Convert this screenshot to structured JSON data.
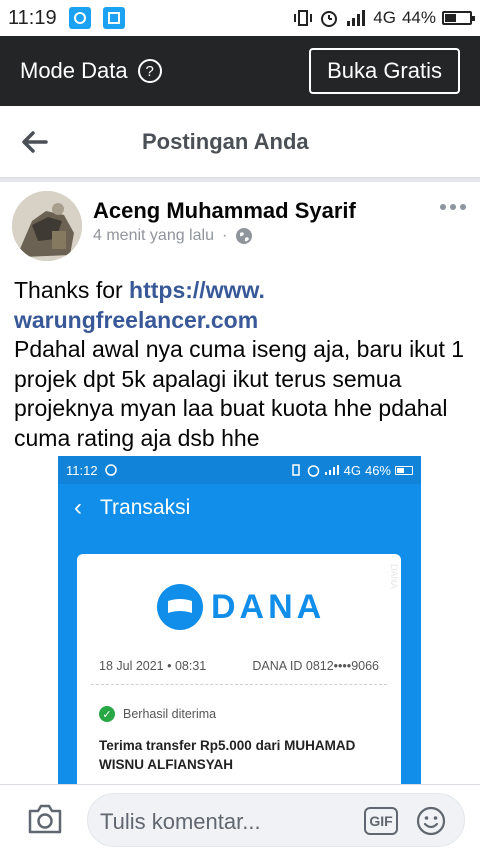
{
  "status_bar": {
    "time": "11:19",
    "network": "4G",
    "battery": "44%",
    "battery_level": 0.44
  },
  "mode_bar": {
    "label": "Mode Data",
    "help_icon": "question-icon",
    "button": "Buka Gratis"
  },
  "header": {
    "back_icon": "arrow-left-icon",
    "title": "Postingan Anda"
  },
  "post": {
    "author": "Aceng Muhammad Syarif",
    "time": "4 menit yang lalu",
    "separator": "·",
    "privacy_icon": "globe-icon",
    "text_prefix": "Thanks for ",
    "link": "https://www.\nwarungfreelancer.com",
    "text_body": "Pdahal awal nya cuma iseng aja, baru ikut 1 projek dpt 5k apalagi ikut terus semua projeknya myan laa buat kuota hhe pdahal cuma rating aja dsb hhe"
  },
  "embedded": {
    "status_time": "11:12",
    "status_network": "4G",
    "status_battery": "46%",
    "battery_level": 0.46,
    "nav_back": "‹",
    "nav_title": "Transaksi",
    "logo_text": "DANA",
    "date": "18 Jul 2021 • 08:31",
    "dana_id": "DANA ID 0812••••9066",
    "status": "Berhasil diterima",
    "description": "Terima transfer Rp5.000 dari MUHAMAD WISNU ALFIANSYAH",
    "watermark": "DANA"
  },
  "comment_bar": {
    "camera_icon": "camera-icon",
    "placeholder": "Tulis komentar...",
    "gif_label": "GIF",
    "emoji_icon": "smiley-icon"
  },
  "colors": {
    "dark_bar": "#242526",
    "link": "#385898",
    "dana_blue": "#118eea",
    "success": "#27a844"
  }
}
